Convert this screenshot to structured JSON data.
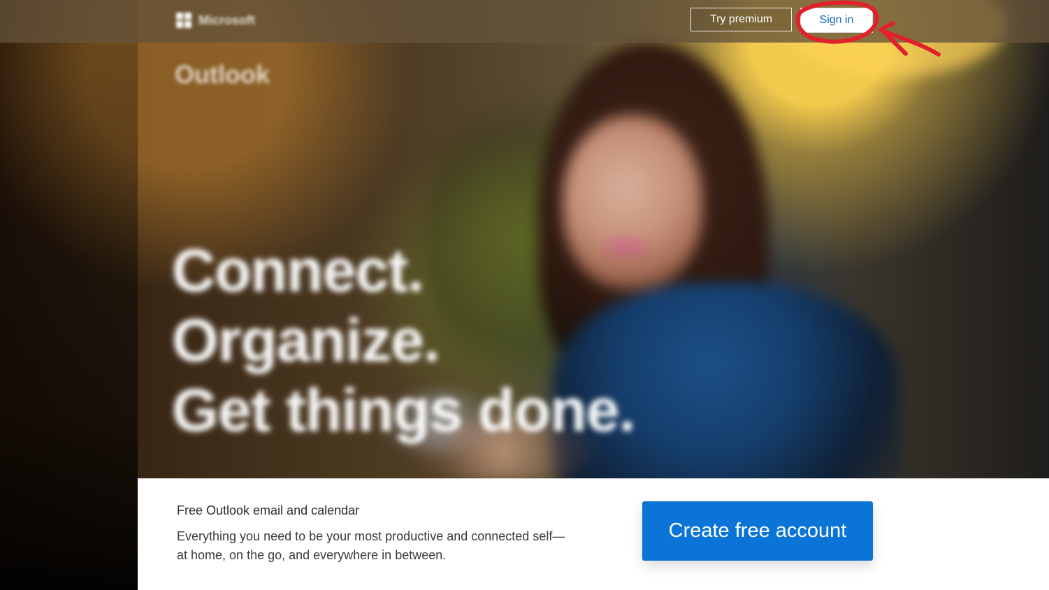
{
  "header": {
    "brand_text": "Microsoft",
    "try_premium_label": "Try premium",
    "sign_in_label": "Sign in"
  },
  "hero": {
    "product_name": "Outlook",
    "headline_lines": [
      "Connect.",
      "Organize.",
      "Get things done."
    ]
  },
  "promo_panel": {
    "title": "Free Outlook email and calendar",
    "description": "Everything you need to be your most productive and connected self—at home, on the go, and everywhere in between.",
    "cta_label": "Create free account"
  },
  "colors": {
    "accent_blue": "#0A75D6",
    "link_blue": "#0F6CBD",
    "annotation_red": "#E0202B"
  },
  "icons": {
    "brand_logo": "microsoft-logo-icon",
    "annotation_circle": "red-circle-annotation-icon",
    "annotation_arrow": "red-arrow-annotation-icon"
  }
}
